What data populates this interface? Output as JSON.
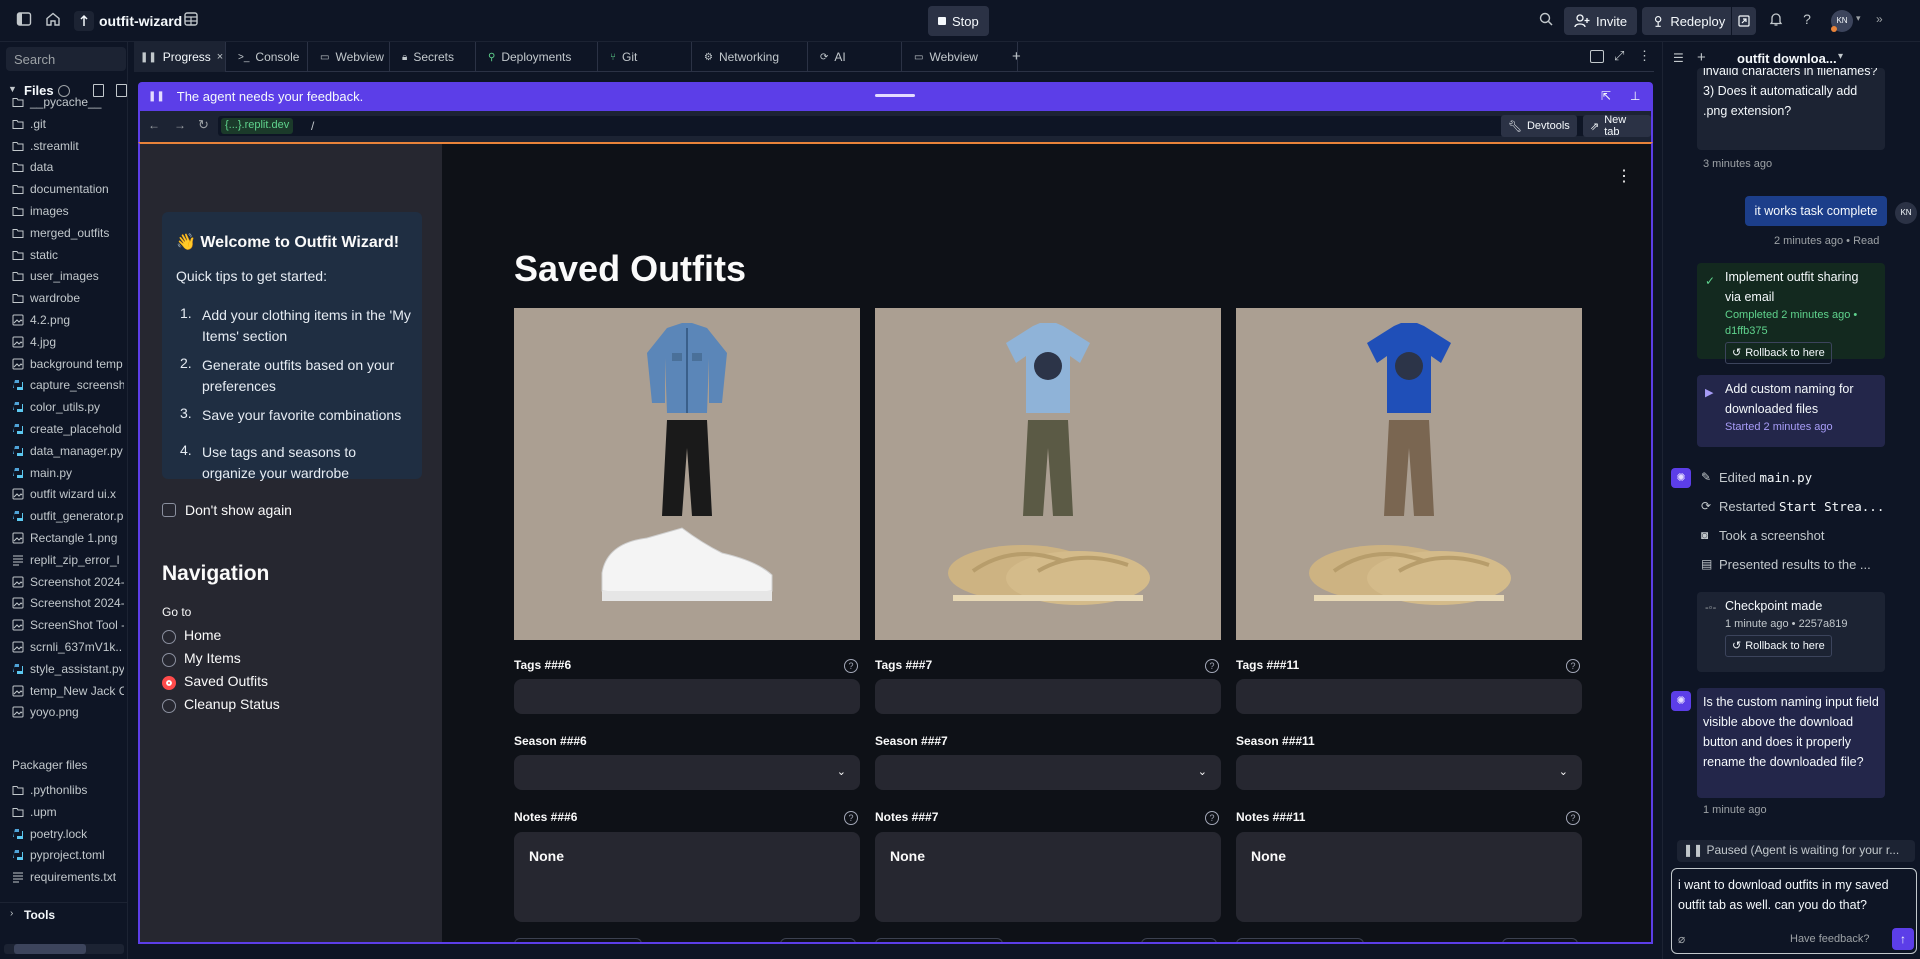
{
  "topbar": {
    "project_name": "outfit-wizard",
    "stop_label": "Stop",
    "invite_label": "Invite",
    "redeploy_label": "Redeploy",
    "avatar_initials": "KN"
  },
  "sidebar": {
    "search_placeholder": "Search",
    "files_title": "Files",
    "files": [
      {
        "name": "__pycache__",
        "type": "folder"
      },
      {
        "name": ".git",
        "type": "folder"
      },
      {
        "name": ".streamlit",
        "type": "folder"
      },
      {
        "name": "data",
        "type": "folder"
      },
      {
        "name": "documentation",
        "type": "folder"
      },
      {
        "name": "images",
        "type": "folder"
      },
      {
        "name": "merged_outfits",
        "type": "folder"
      },
      {
        "name": "static",
        "type": "folder"
      },
      {
        "name": "user_images",
        "type": "folder"
      },
      {
        "name": "wardrobe",
        "type": "folder"
      },
      {
        "name": "4.2.png",
        "type": "image"
      },
      {
        "name": "4.jpg",
        "type": "image"
      },
      {
        "name": "background temp",
        "type": "image"
      },
      {
        "name": "capture_screensh",
        "type": "python"
      },
      {
        "name": "color_utils.py",
        "type": "python"
      },
      {
        "name": "create_placehold",
        "type": "python"
      },
      {
        "name": "data_manager.py",
        "type": "python"
      },
      {
        "name": "main.py",
        "type": "python"
      },
      {
        "name": "outfit wizard ui.x",
        "type": "image"
      },
      {
        "name": "outfit_generator.p",
        "type": "python"
      },
      {
        "name": "Rectangle 1.png",
        "type": "image"
      },
      {
        "name": "replit_zip_error_l",
        "type": "text"
      },
      {
        "name": "Screenshot 2024-",
        "type": "image"
      },
      {
        "name": "Screenshot 2024-",
        "type": "image"
      },
      {
        "name": "ScreenShot Tool -",
        "type": "image"
      },
      {
        "name": "scrnli_637mV1k..",
        "type": "image"
      },
      {
        "name": "style_assistant.py",
        "type": "python"
      },
      {
        "name": "temp_New Jack C",
        "type": "image"
      },
      {
        "name": "yoyo.png",
        "type": "image"
      }
    ],
    "packager_title": "Packager files",
    "packager": [
      {
        "name": ".pythonlibs",
        "type": "folder"
      },
      {
        "name": ".upm",
        "type": "folder"
      },
      {
        "name": "poetry.lock",
        "type": "python"
      },
      {
        "name": "pyproject.toml",
        "type": "python"
      },
      {
        "name": "requirements.txt",
        "type": "text"
      }
    ],
    "tools_label": "Tools"
  },
  "tabs": [
    {
      "label": "Progress",
      "icon": "progress-icon",
      "active": true
    },
    {
      "label": "Console",
      "icon": "console-icon"
    },
    {
      "label": "Webview",
      "icon": "monitor-icon"
    },
    {
      "label": "Secrets",
      "icon": "lock-icon"
    },
    {
      "label": "Deployments",
      "icon": "deploy-icon"
    },
    {
      "label": "Git",
      "icon": "git-icon"
    },
    {
      "label": "Networking",
      "icon": "network-icon"
    },
    {
      "label": "AI",
      "icon": "ai-icon"
    },
    {
      "label": "Webview",
      "icon": "monitor-icon"
    }
  ],
  "webview": {
    "banner_text": "The agent needs your feedback.",
    "url_domain": "{...}.replit.dev",
    "url_path": "/",
    "devtools_label": "Devtools",
    "newtab_label": "New tab"
  },
  "app": {
    "welcome_title": "👋 Welcome to Outfit Wizard!",
    "tips_intro": "Quick tips to get started:",
    "tips": [
      "Add your clothing items in the 'My Items' section",
      "Generate outfits based on your preferences",
      "Save your favorite combinations",
      "Use tags and seasons to organize your wardrobe"
    ],
    "dont_show": "Don't show again",
    "nav_title": "Navigation",
    "goto_label": "Go to",
    "nav_options": [
      "Home",
      "My Items",
      "Saved Outfits",
      "Cleanup Status"
    ],
    "nav_selected": "Saved Outfits",
    "page_title": "Saved Outfits",
    "outfits": [
      {
        "tags_label": "Tags ###6",
        "season_label": "Season ###6",
        "notes_label": "Notes ###6",
        "notes_value": "None",
        "top": "denim jacket",
        "bottom": "black jeans",
        "shoes": "white sneakers"
      },
      {
        "tags_label": "Tags ###7",
        "season_label": "Season ###7",
        "notes_label": "Notes ###7",
        "notes_value": "None",
        "top": "light blue t-shirt",
        "bottom": "camo cargo pants",
        "shoes": "tan loafers"
      },
      {
        "tags_label": "Tags ###11",
        "season_label": "Season ###11",
        "notes_label": "Notes ###11",
        "notes_value": "None",
        "top": "blue graphic t-shirt",
        "bottom": "brown trousers",
        "shoes": "tan loafers"
      }
    ]
  },
  "chat": {
    "title": "outfit downloa...",
    "partial_msg": "invalid characters in filenames? 3) Does it automatically add .png extension?",
    "partial_time": "3 minutes ago",
    "user_msg": "it works task complete",
    "user_meta": "2 minutes ago • Read",
    "user_avatar": "KN",
    "done_task": "Implement outfit sharing via email",
    "done_meta": "Completed 2 minutes ago • d1ffb375",
    "rollback_label": "Rollback to here",
    "started_task": "Add custom naming for downloaded files",
    "started_meta": "Started 2 minutes ago",
    "actions": [
      {
        "prefix": "Edited ",
        "code": "main.py",
        "icon": "edit-icon"
      },
      {
        "prefix": "Restarted ",
        "code": "Start Strea...",
        "icon": "restart-icon"
      },
      {
        "prefix": "Took a screenshot",
        "code": "",
        "icon": "camera-icon"
      },
      {
        "prefix": "Presented results to the ...",
        "code": "",
        "icon": "present-icon"
      }
    ],
    "checkpoint_title": "Checkpoint made",
    "checkpoint_meta": "1 minute ago • 2257a819",
    "agent_question": "Is the custom naming input field visible above the download button and does it properly rename the downloaded file?",
    "agent_time": "1 minute ago",
    "paused_text": "Paused (Agent is waiting for your r...",
    "input_value": "i want to download outfits in my saved outfit tab as well. can you do that?",
    "feedback_label": "Have feedback?"
  }
}
